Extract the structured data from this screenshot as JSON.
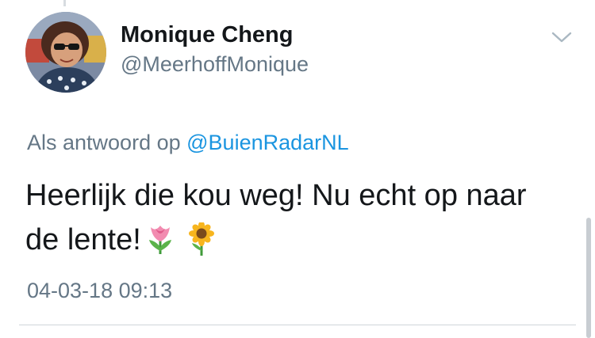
{
  "user": {
    "display_name": "Monique Cheng",
    "handle": "@MeerhoffMonique"
  },
  "reply_context": {
    "prefix": "Als antwoord op",
    "mention": "@BuienRadarNL"
  },
  "tweet": {
    "text_line1": "Heerlijk die kou weg! Nu echt op naar",
    "text_line2": "de lente!",
    "emojis": [
      "tulip-icon",
      "sunflower-icon"
    ],
    "timestamp": "04-03-18 09:13"
  },
  "colors": {
    "primary_text": "#14171a",
    "secondary_text": "#657786",
    "link": "#1b95e0",
    "divider": "#d0d5da"
  },
  "icons": {
    "menu": "chevron-down-icon"
  }
}
